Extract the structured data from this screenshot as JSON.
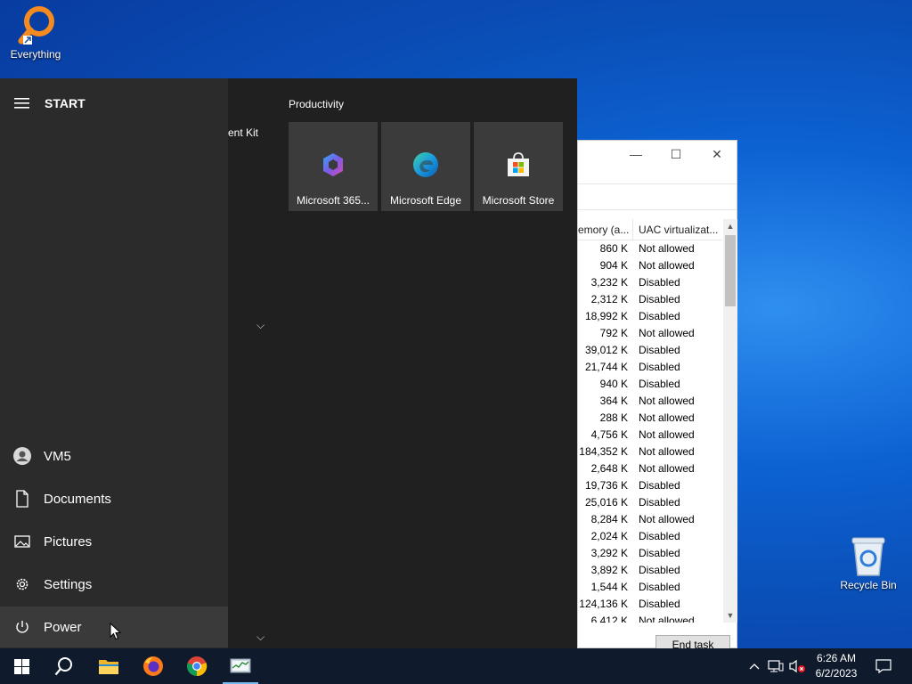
{
  "desktop": {
    "icons": [
      {
        "label": "Everything",
        "icon": "everything-magnifier-icon"
      },
      {
        "label": "Recycle Bin",
        "icon": "recycle-bin-icon"
      }
    ]
  },
  "task_manager": {
    "columns": [
      "emory (a...",
      "UAC virtualizat..."
    ],
    "rows": [
      [
        "860 K",
        "Not allowed"
      ],
      [
        "904 K",
        "Not allowed"
      ],
      [
        "3,232 K",
        "Disabled"
      ],
      [
        "2,312 K",
        "Disabled"
      ],
      [
        "18,992 K",
        "Disabled"
      ],
      [
        "792 K",
        "Not allowed"
      ],
      [
        "39,012 K",
        "Disabled"
      ],
      [
        "21,744 K",
        "Disabled"
      ],
      [
        "940 K",
        "Disabled"
      ],
      [
        "364 K",
        "Not allowed"
      ],
      [
        "288 K",
        "Not allowed"
      ],
      [
        "4,756 K",
        "Not allowed"
      ],
      [
        "184,352 K",
        "Not allowed"
      ],
      [
        "2,648 K",
        "Not allowed"
      ],
      [
        "19,736 K",
        "Disabled"
      ],
      [
        "25,016 K",
        "Disabled"
      ],
      [
        "8,284 K",
        "Not allowed"
      ],
      [
        "2,024 K",
        "Disabled"
      ],
      [
        "3,292 K",
        "Disabled"
      ],
      [
        "3,892 K",
        "Disabled"
      ],
      [
        "1,544 K",
        "Disabled"
      ],
      [
        "124,136 K",
        "Disabled"
      ],
      [
        "6,412 K",
        "Not allowed"
      ]
    ],
    "end_task_label": "End task"
  },
  "start_menu": {
    "title": "START",
    "applist_fragment": "ent Kit",
    "nav": [
      {
        "label": "VM5",
        "icon": "user-avatar-icon"
      },
      {
        "label": "Documents",
        "icon": "document-icon"
      },
      {
        "label": "Pictures",
        "icon": "pictures-icon"
      },
      {
        "label": "Settings",
        "icon": "gear-icon"
      },
      {
        "label": "Power",
        "icon": "power-icon"
      }
    ],
    "group_title": "Productivity",
    "tiles": [
      {
        "label": "Microsoft 365...",
        "icon": "microsoft-365-icon"
      },
      {
        "label": "Microsoft Edge",
        "icon": "edge-icon"
      },
      {
        "label": "Microsoft Store",
        "icon": "store-icon"
      }
    ]
  },
  "taskbar": {
    "apps": [
      "start-windows-icon",
      "search-icon",
      "file-explorer-icon",
      "firefox-icon",
      "chrome-icon",
      "task-manager-icon"
    ],
    "clock": {
      "time": "6:26 AM",
      "date": "6/2/2023"
    }
  }
}
